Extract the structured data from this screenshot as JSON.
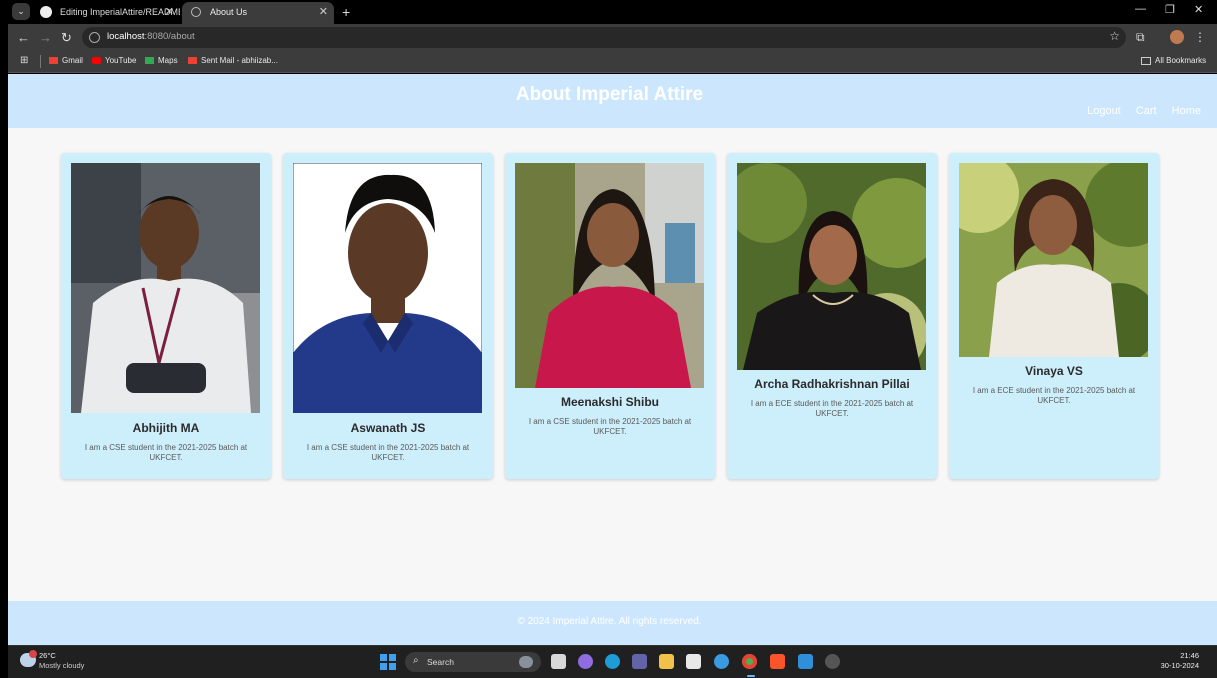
{
  "browser": {
    "tabs": [
      {
        "title": "Editing ImperialAttire/README",
        "active": false
      },
      {
        "title": "About Us",
        "active": true
      }
    ],
    "url_host": "localhost",
    "url_path": ":8080/about",
    "bookmarks": [
      {
        "label": "Gmail",
        "icon": "gmail-icon",
        "color": "#ea4335"
      },
      {
        "label": "YouTube",
        "icon": "youtube-icon",
        "color": "#ff0000"
      },
      {
        "label": "Maps",
        "icon": "maps-icon",
        "color": "#34a853"
      },
      {
        "label": "Sent Mail - abhiizab...",
        "icon": "gmail-icon",
        "color": "#ea4335"
      }
    ],
    "all_bookmarks_label": "All Bookmarks"
  },
  "site": {
    "title": "About Imperial Attire",
    "nav": [
      "Logout",
      "Cart",
      "Home"
    ],
    "header_color": "#cce7fd",
    "card_color": "#cdeefb",
    "team": [
      {
        "name": "Abhijith MA",
        "bio": "I am a CSE student in the 2021-2025 batch at UKFCET."
      },
      {
        "name": "Aswanath JS",
        "bio": "I am a CSE student in the 2021-2025 batch at UKFCET."
      },
      {
        "name": "Meenakshi Shibu",
        "bio": "I am a CSE student in the 2021-2025 batch at UKFCET."
      },
      {
        "name": "Archa Radhakrishnan Pillai",
        "bio": "I am a ECE student in the 2021-2025 batch at UKFCET."
      },
      {
        "name": "Vinaya VS",
        "bio": "I am a ECE student in the 2021-2025 batch at UKFCET."
      }
    ],
    "footer": "© 2024 Imperial Attire. All rights reserved."
  },
  "taskbar": {
    "weather_temp": "26°C",
    "weather_desc": "Mostly cloudy",
    "weather_badge": "1",
    "search_label": "Search",
    "time": "21:46",
    "date": "30-10-2024"
  }
}
